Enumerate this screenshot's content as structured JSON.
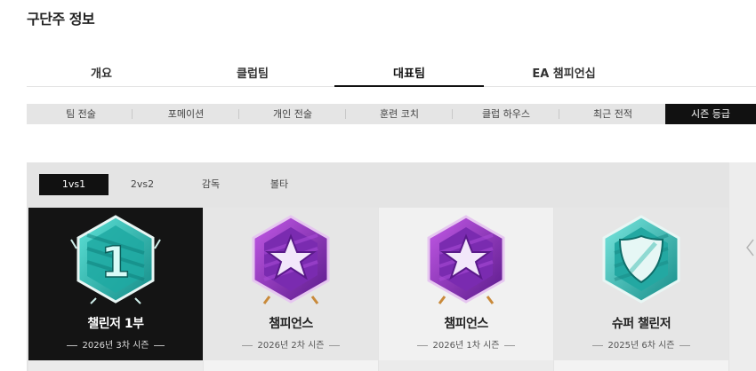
{
  "page": {
    "title": "구단주 정보"
  },
  "main_tabs": [
    {
      "label": "개요",
      "active": false
    },
    {
      "label": "클럽팀",
      "active": false
    },
    {
      "label": "대표팀",
      "active": true
    },
    {
      "label": "EA 챔피언십",
      "active": false
    }
  ],
  "sub_tabs": [
    {
      "label": "팀 전술",
      "active": false
    },
    {
      "label": "포메이션",
      "active": false
    },
    {
      "label": "개인 전술",
      "active": false
    },
    {
      "label": "훈련 코치",
      "active": false
    },
    {
      "label": "클럽 하우스",
      "active": false
    },
    {
      "label": "최근 전적",
      "active": false
    },
    {
      "label": "시즌 등급",
      "active": true
    }
  ],
  "mode_tabs": [
    {
      "label": "1vs1",
      "active": true
    },
    {
      "label": "2vs2",
      "active": false
    },
    {
      "label": "감독",
      "active": false
    },
    {
      "label": "볼타",
      "active": false
    }
  ],
  "rank_cards": [
    {
      "name": "챌린저 1부",
      "season": "2026년 3차 시즌",
      "badge": "challenger-1-icon",
      "active": true
    },
    {
      "name": "챔피언스",
      "season": "2026년 2차 시즌",
      "badge": "champions-star-icon",
      "active": false
    },
    {
      "name": "챔피언스",
      "season": "2026년 1차 시즌",
      "badge": "champions-star-icon",
      "active": false
    },
    {
      "name": "슈퍼 챌린저",
      "season": "2025년 6차 시즌",
      "badge": "super-challenger-shield-icon",
      "active": false
    }
  ],
  "colors": {
    "active_bg": "#111111",
    "teal_badge": "#2fb8b0",
    "purple_badge": "#8a2fc0"
  }
}
